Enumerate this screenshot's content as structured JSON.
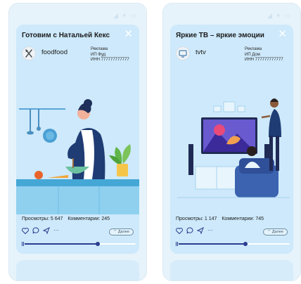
{
  "status_icons": "◢ ▾ ▭",
  "posts": [
    {
      "title": "Готовим  с Натальей Кекс",
      "channel": "foodfood",
      "ad_lines": [
        "Реклама",
        "ИП Фуд",
        "ИНН 777777777777"
      ],
      "views": "Просмотры: 5 647",
      "comments": "Комментарии: 245",
      "more_label": "Далее",
      "progress": 0.66,
      "avatar_icon": "cutlery-icon",
      "illustration": "woman-cooking-kitchen"
    },
    {
      "title": "Яркие ТВ – яркие эмоции",
      "channel": "tvtv",
      "ad_lines": [
        "Реклама",
        "ИП Дом",
        "ИНН 777777777777"
      ],
      "views": "Просмотры: 1 147",
      "comments": "Комментарии: 745",
      "more_label": "Далее",
      "progress": 0.6,
      "avatar_icon": "tv-icon",
      "illustration": "people-watching-tv"
    }
  ],
  "colors": {
    "card_bg": "#cde9fb",
    "accent": "#2a3d8f",
    "phone_bg": "#e6f3fb"
  }
}
